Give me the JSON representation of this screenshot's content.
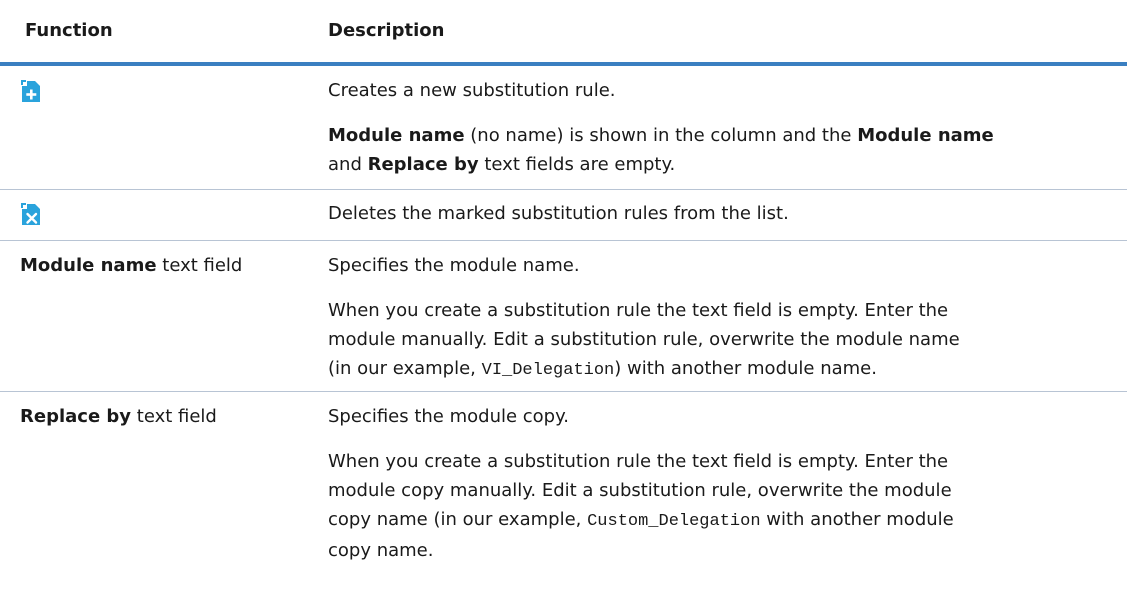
{
  "header": {
    "function": "Function",
    "description": "Description"
  },
  "rows": [
    {
      "icon": "new-document-plus-icon",
      "paragraphs": [
        {
          "text": "Creates a new substitution rule."
        },
        {
          "b1": "Module name",
          "t1": " (no name) is shown in the column and the ",
          "b2": "Module name",
          "t2": " and ",
          "b3": "Replace by",
          "t3": " text fields are empty."
        }
      ]
    },
    {
      "icon": "delete-document-x-icon",
      "paragraphs": [
        {
          "text": "Deletes the marked substitution rules from the list."
        }
      ]
    },
    {
      "function_bold": "Module name",
      "function_rest": " text field",
      "paragraphs": [
        {
          "text": "Specifies the module name."
        },
        {
          "l1": "When you create a substitution rule the text field is empty. Enter the",
          "l2": "module manually. Edit a substitution rule, overwrite the module name",
          "l3_pre": "(in our example, ",
          "l3_code": "VI_Delegation",
          "l3_post": ") with another module name."
        }
      ]
    },
    {
      "function_bold": "Replace by",
      "function_rest": " text field",
      "paragraphs": [
        {
          "text": "Specifies the module copy."
        },
        {
          "l1": "When you create a substitution rule the text field is empty. Enter the",
          "l2": "module copy manually. Edit a substitution rule, overwrite the module",
          "l3_pre": "copy name (in our example, ",
          "l3_code": "Custom_Delegation",
          "l3_post": " with another module",
          "l4": "copy name."
        }
      ]
    }
  ],
  "colors": {
    "accent": "#3a7fc1",
    "icon_blue": "#2aa3dc"
  }
}
